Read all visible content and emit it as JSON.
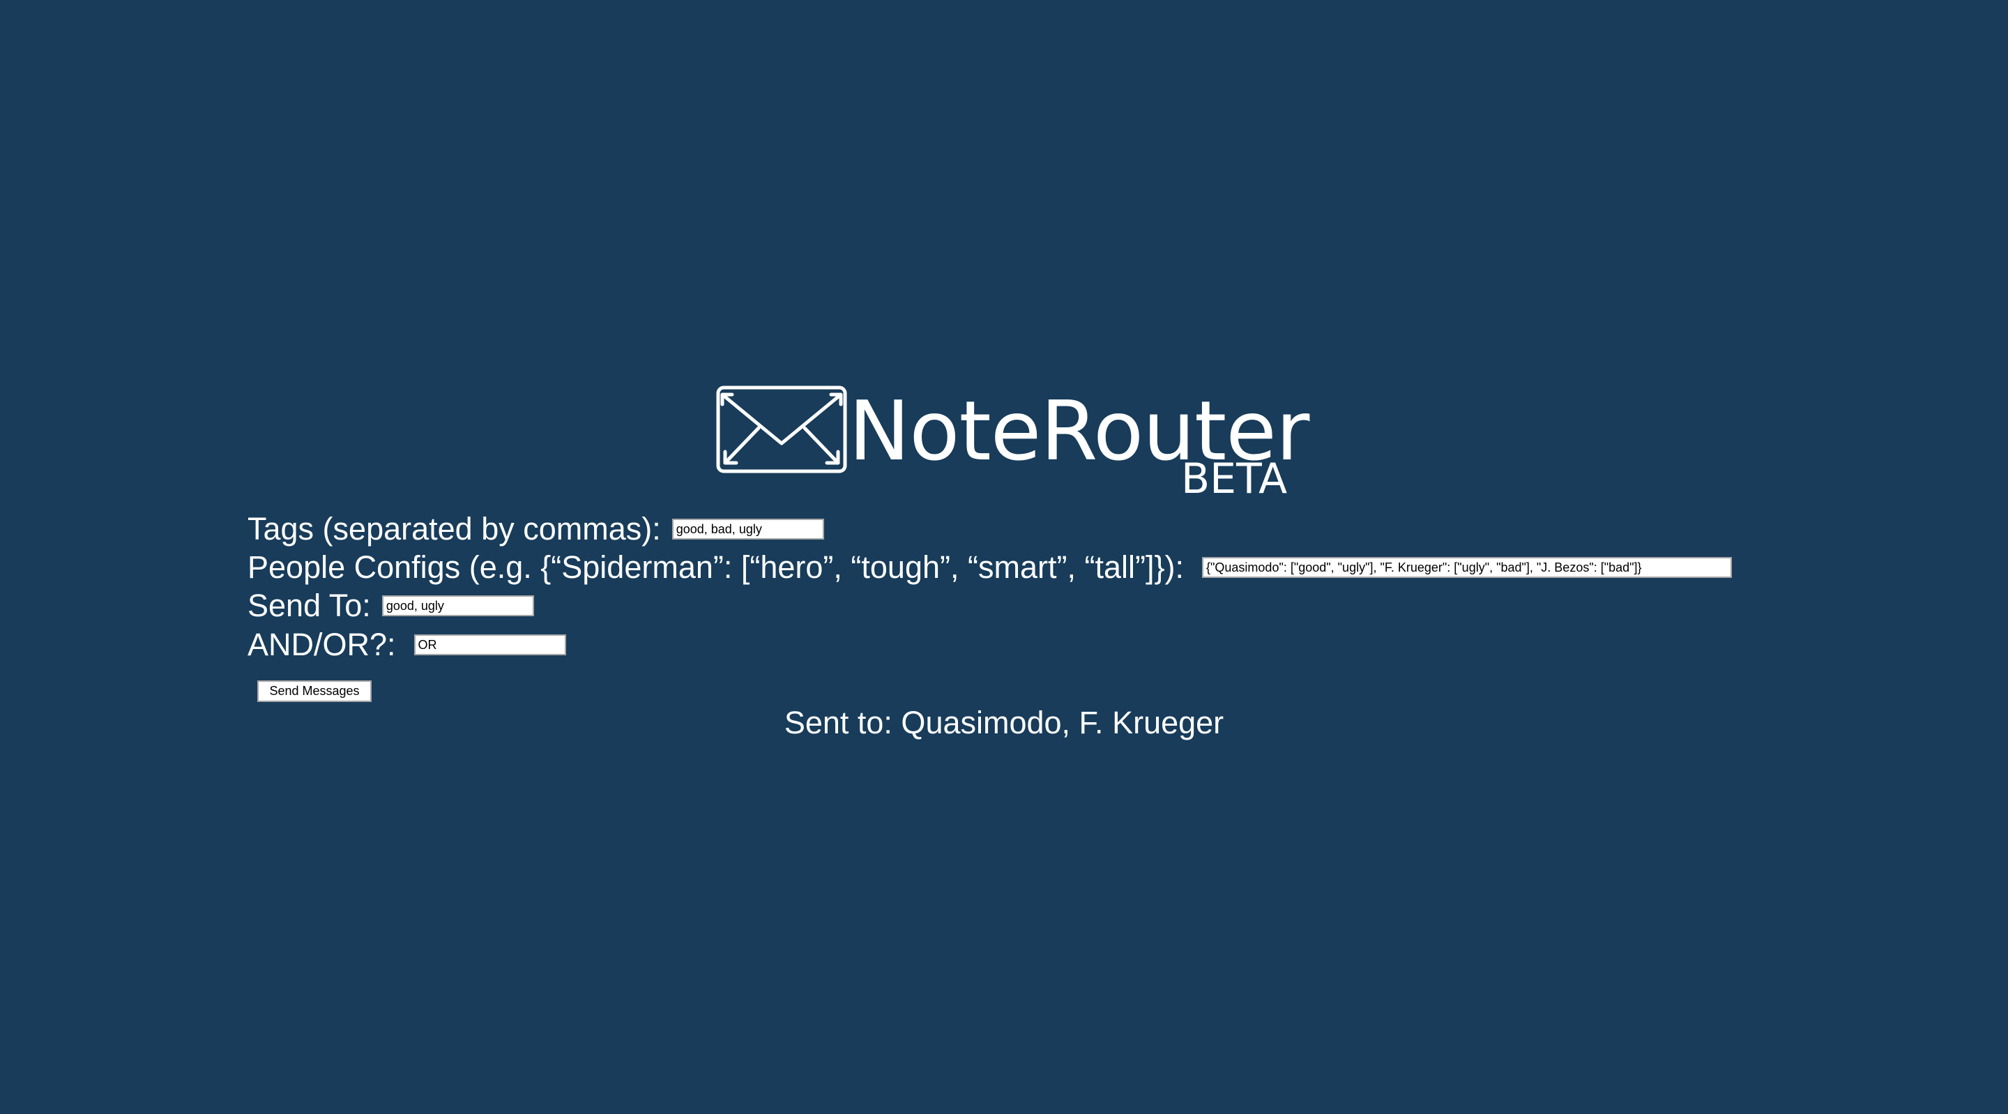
{
  "app": {
    "title": "NoteRouter",
    "badge": "BETA",
    "logo_icon": "envelope-icon"
  },
  "form": {
    "tags": {
      "label": "Tags (separated by commas):",
      "value": "good, bad, ugly"
    },
    "people": {
      "label": "People Configs (e.g. {“Spiderman”: [“hero”, “tough”, “smart”, “tall”]}):",
      "value": "{\"Quasimodo\": [\"good\", \"ugly\"], \"F. Krueger\": [\"ugly\", \"bad\"], \"J. Bezos\": [\"bad\"]}"
    },
    "send_to": {
      "label": "Send To:",
      "value": "good, ugly"
    },
    "and_or": {
      "label": "AND/OR?:",
      "value": "OR"
    },
    "submit_label": "Send Messages"
  },
  "result": {
    "text": "Sent to: Quasimodo, F. Krueger"
  },
  "colors": {
    "background": "#183c5a",
    "text": "#ffffff"
  }
}
